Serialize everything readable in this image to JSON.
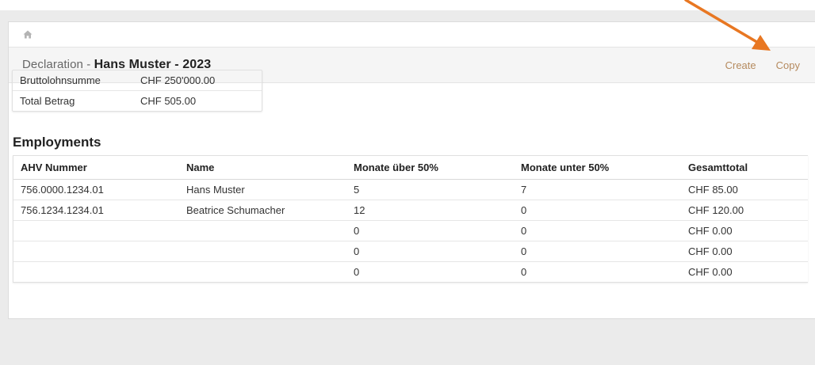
{
  "header": {
    "prefix": "Declaration - ",
    "title": "Hans Muster - 2023",
    "actions": {
      "create": "Create",
      "copy": "Copy"
    }
  },
  "summary": [
    {
      "label": "Bruttolohnsumme",
      "value": "CHF 250'000.00"
    },
    {
      "label": "Total Betrag",
      "value": "CHF 505.00"
    }
  ],
  "employments": {
    "title": "Employments",
    "columns": [
      "AHV Nummer",
      "Name",
      "Monate über 50%",
      "Monate unter 50%",
      "Gesamttotal"
    ],
    "rows": [
      [
        "756.0000.1234.01",
        "Hans Muster",
        "5",
        "7",
        "CHF 85.00"
      ],
      [
        "756.1234.1234.01",
        "Beatrice Schumacher",
        "12",
        "0",
        "CHF 120.00"
      ],
      [
        "",
        "",
        "0",
        "0",
        "CHF 0.00"
      ],
      [
        "",
        "",
        "0",
        "0",
        "CHF 0.00"
      ],
      [
        "",
        "",
        "0",
        "0",
        "CHF 0.00"
      ]
    ]
  },
  "colors": {
    "link": "#b58a5e",
    "annotation_arrow": "#e87722"
  },
  "icons": {
    "breadcrumb": "home-icon"
  }
}
